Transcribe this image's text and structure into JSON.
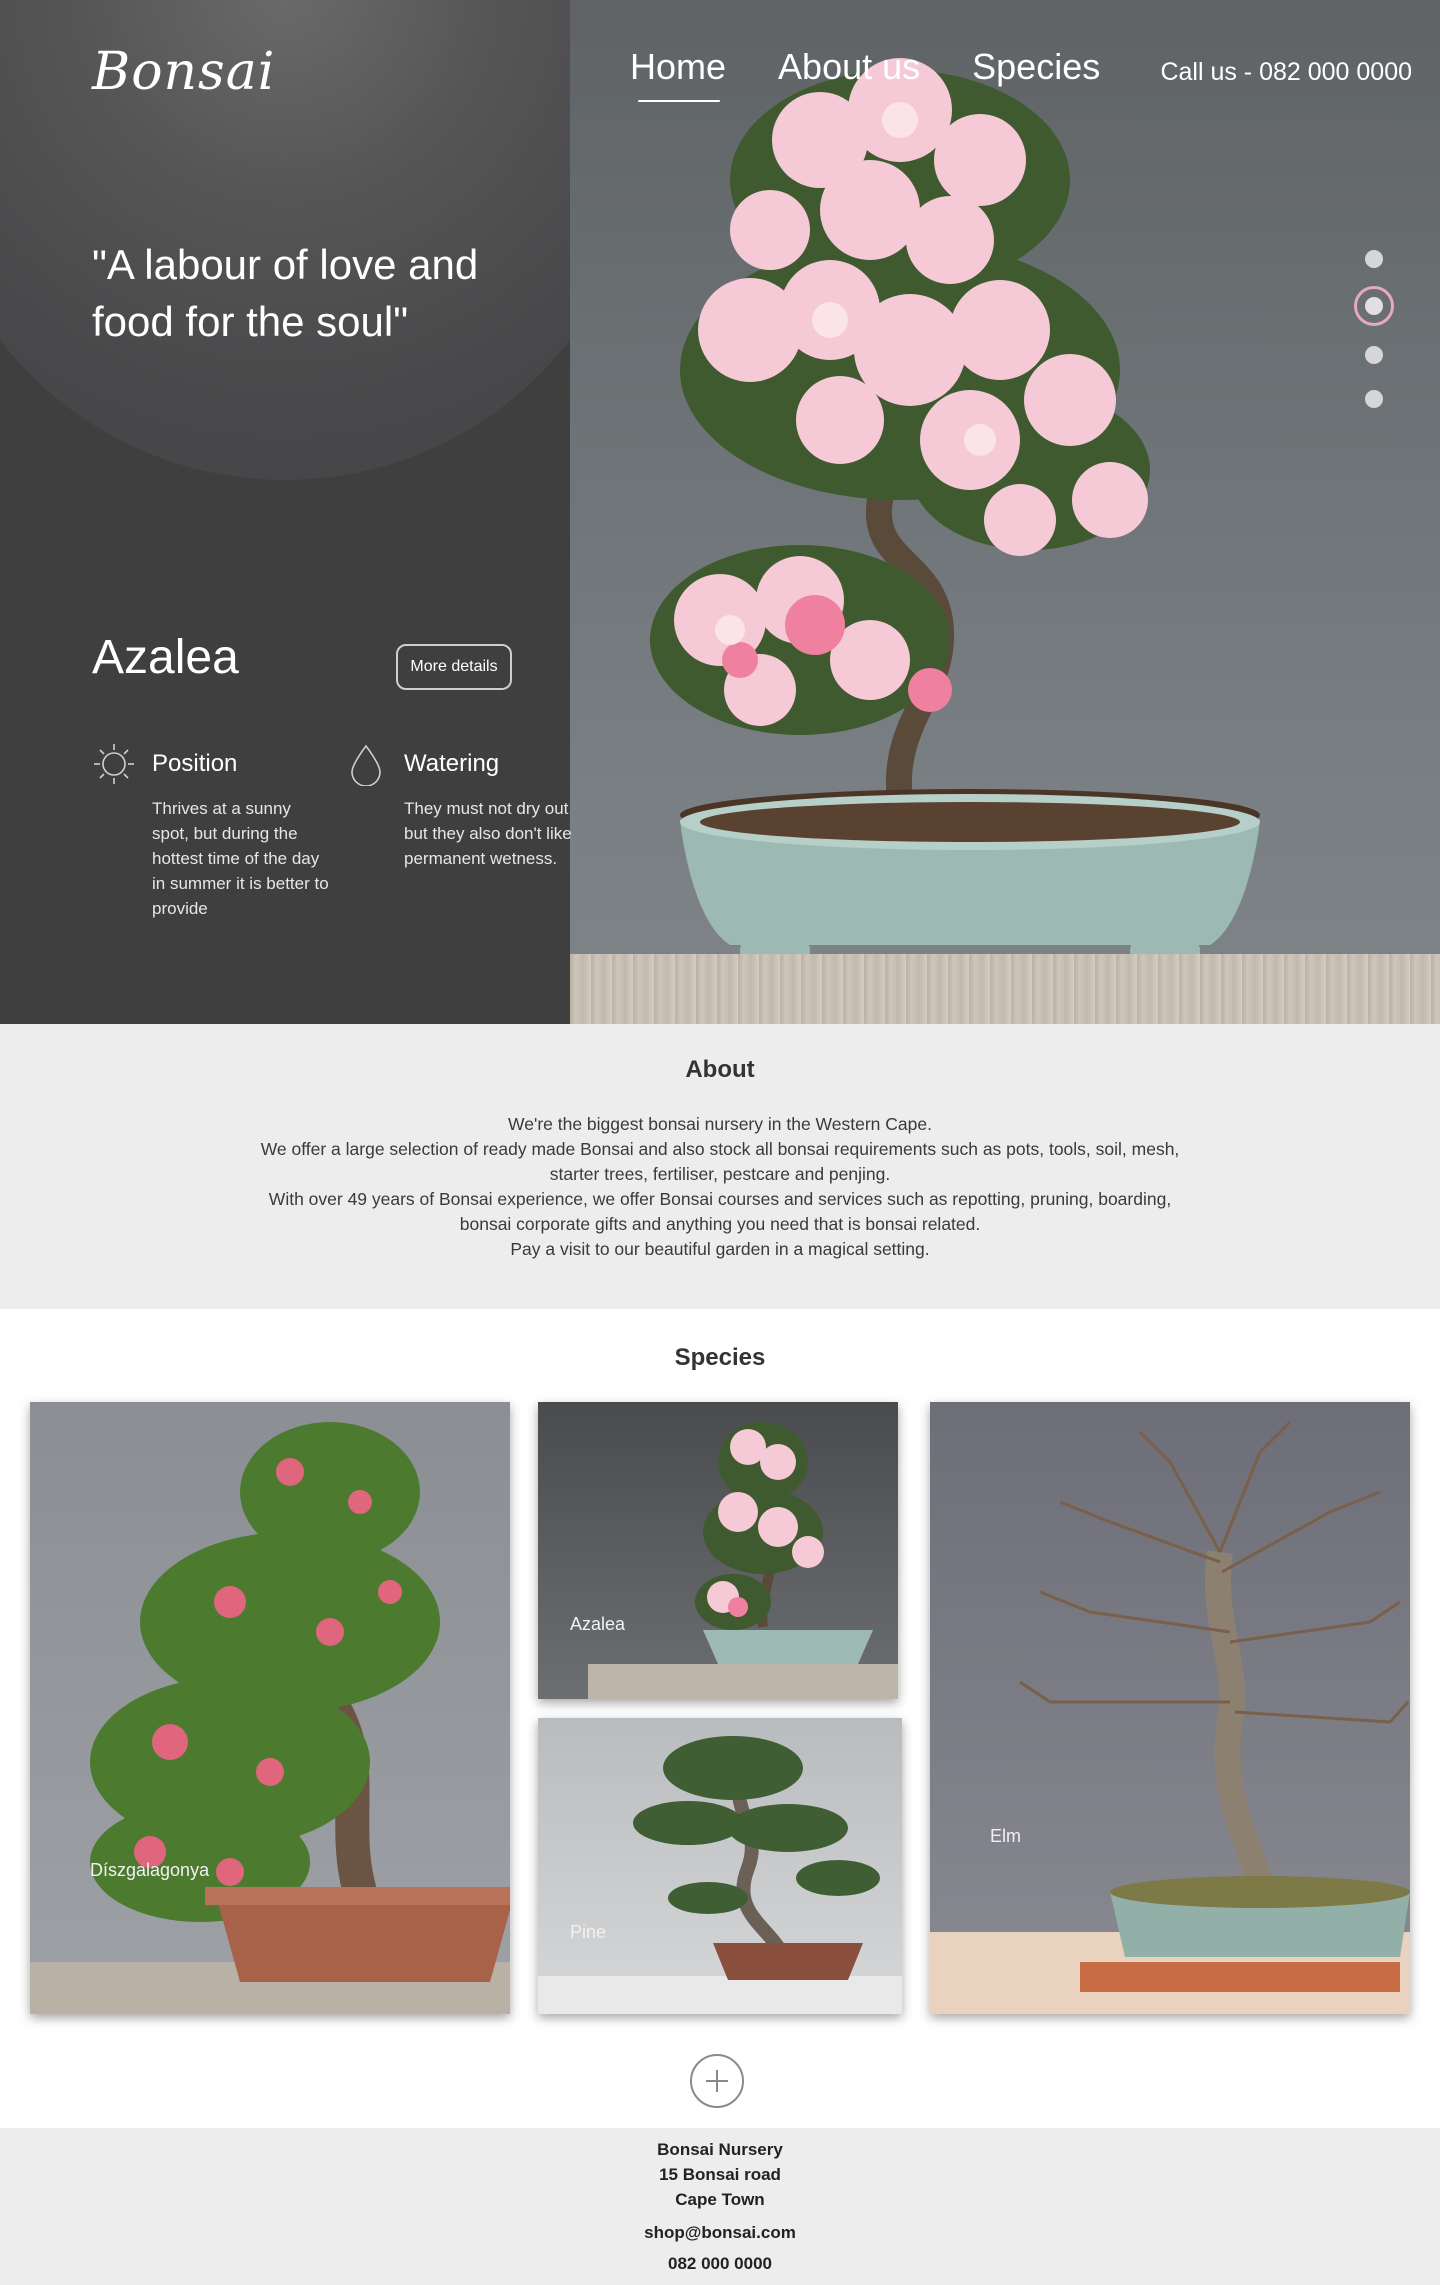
{
  "header": {
    "logo": "Bonsai",
    "nav": [
      "Home",
      "About us",
      "Species"
    ],
    "active_nav": "Home",
    "call": "Call us - 082 000 0000"
  },
  "hero": {
    "quote": "\"A labour of love and food for the soul\"",
    "species_name": "Azalea",
    "more_details": "More details",
    "slides_total": 4,
    "slide_active": 2,
    "care": [
      {
        "icon": "sun-icon",
        "title": "Position",
        "text": "Thrives at a sunny spot, but during the hottest time of the day in summer it is better to provide"
      },
      {
        "icon": "water-drop-icon",
        "title": "Watering",
        "text": "They must not dry out but they also don't like permanent wetness."
      }
    ]
  },
  "about": {
    "title": "About",
    "lines": [
      "We're the biggest bonsai nursery in the Western Cape.",
      "We offer a large selection of ready made Bonsai and also stock all bonsai requirements such as pots, tools, soil, mesh, starter trees, fertiliser, pestcare and penjing.",
      "With over 49 years of Bonsai experience, we offer Bonsai courses and services such as repotting, pruning, boarding, bonsai corporate gifts and anything you need that is bonsai related.",
      "Pay a visit to our beautiful garden in a magical setting."
    ]
  },
  "species": {
    "title": "Species",
    "cards": [
      {
        "name": "Díszgalagonya"
      },
      {
        "name": "Azalea"
      },
      {
        "name": "Pine"
      },
      {
        "name": "Elm"
      }
    ],
    "more_icon": "plus-icon"
  },
  "footer": {
    "name": "Bonsai Nursery",
    "street": "15 Bonsai road",
    "city": "Cape Town",
    "email": "shop@bonsai.com",
    "phone": "082 000 0000"
  },
  "colors": {
    "hero_panel": "#3f3f40",
    "active_dot_ring": "#e6a9c0",
    "section_bg": "#ededed"
  }
}
